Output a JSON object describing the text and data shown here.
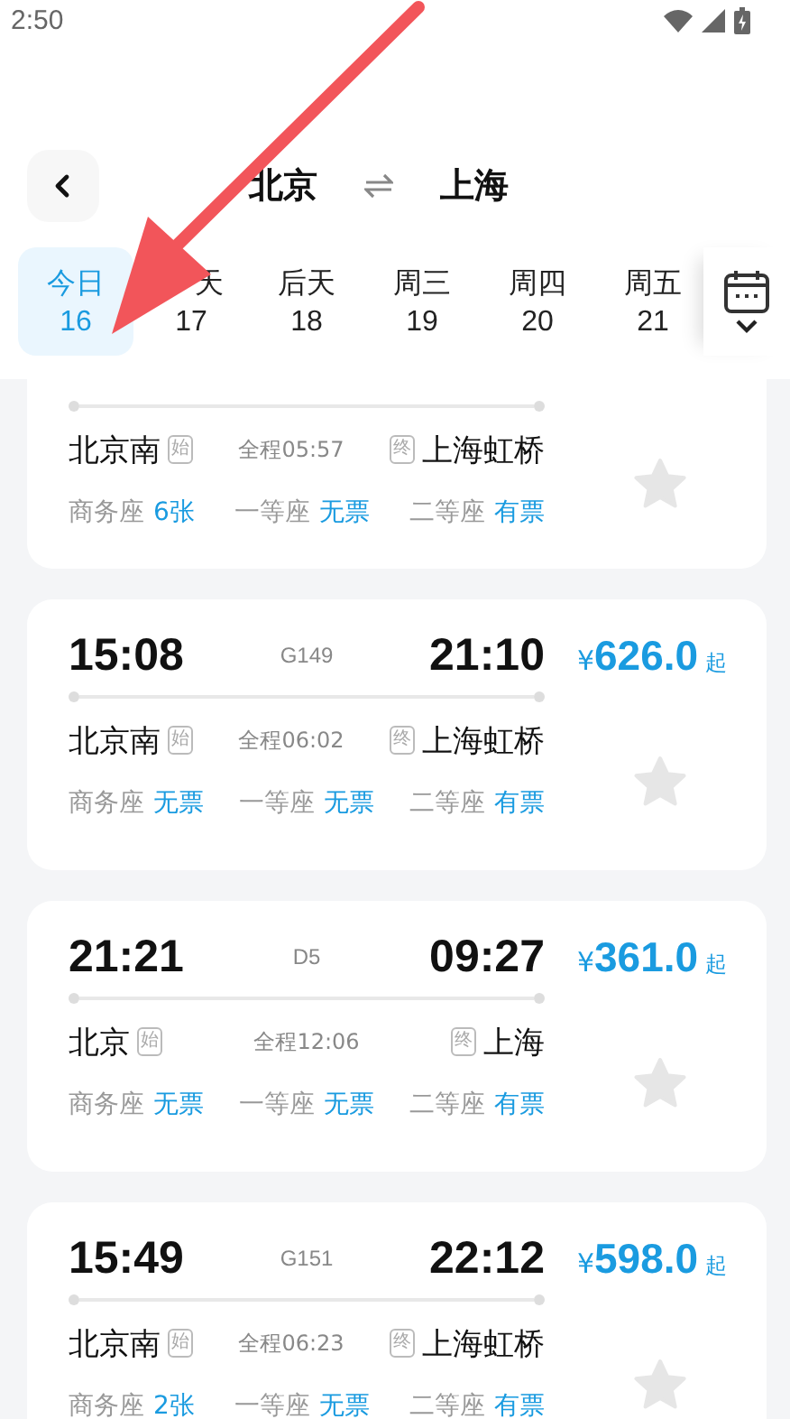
{
  "status_bar": {
    "time": "2:50"
  },
  "header": {
    "from": "北京",
    "to": "上海"
  },
  "dates": [
    {
      "label": "今日",
      "day": "16",
      "selected": true
    },
    {
      "label": "天",
      "day": "17",
      "selected": false
    },
    {
      "label": "后天",
      "day": "18",
      "selected": false
    },
    {
      "label": "周三",
      "day": "19",
      "selected": false
    },
    {
      "label": "周四",
      "day": "20",
      "selected": false
    },
    {
      "label": "周五",
      "day": "21",
      "selected": false
    }
  ],
  "trains": [
    {
      "from_station": "北京南",
      "from_tag": "始",
      "duration": "全程05:57",
      "to_tag": "终",
      "to_station": "上海虹桥",
      "favorite": false,
      "seats": [
        {
          "name": "商务座",
          "status": "6张"
        },
        {
          "name": "一等座",
          "status": "无票"
        },
        {
          "name": "二等座",
          "status": "有票"
        }
      ]
    },
    {
      "depart": "15:08",
      "train_no": "G149",
      "arrive": "21:10",
      "currency": "¥",
      "price": "626.0",
      "price_suffix": "起",
      "from_station": "北京南",
      "from_tag": "始",
      "duration": "全程06:02",
      "to_tag": "终",
      "to_station": "上海虹桥",
      "favorite": false,
      "seats": [
        {
          "name": "商务座",
          "status": "无票"
        },
        {
          "name": "一等座",
          "status": "无票"
        },
        {
          "name": "二等座",
          "status": "有票"
        }
      ]
    },
    {
      "depart": "21:21",
      "train_no": "D5",
      "arrive": "09:27",
      "currency": "¥",
      "price": "361.0",
      "price_suffix": "起",
      "from_station": "北京",
      "from_tag": "始",
      "duration": "全程12:06",
      "to_tag": "终",
      "to_station": "上海",
      "favorite": false,
      "seats": [
        {
          "name": "商务座",
          "status": "无票"
        },
        {
          "name": "一等座",
          "status": "无票"
        },
        {
          "name": "二等座",
          "status": "有票"
        }
      ]
    },
    {
      "depart": "15:49",
      "train_no": "G151",
      "arrive": "22:12",
      "currency": "¥",
      "price": "598.0",
      "price_suffix": "起",
      "from_station": "北京南",
      "from_tag": "始",
      "duration": "全程06:23",
      "to_tag": "终",
      "to_station": "上海虹桥",
      "favorite": false,
      "seats": [
        {
          "name": "商务座",
          "status": "2张"
        },
        {
          "name": "一等座",
          "status": "无票"
        },
        {
          "name": "二等座",
          "status": "有票"
        }
      ]
    }
  ]
}
